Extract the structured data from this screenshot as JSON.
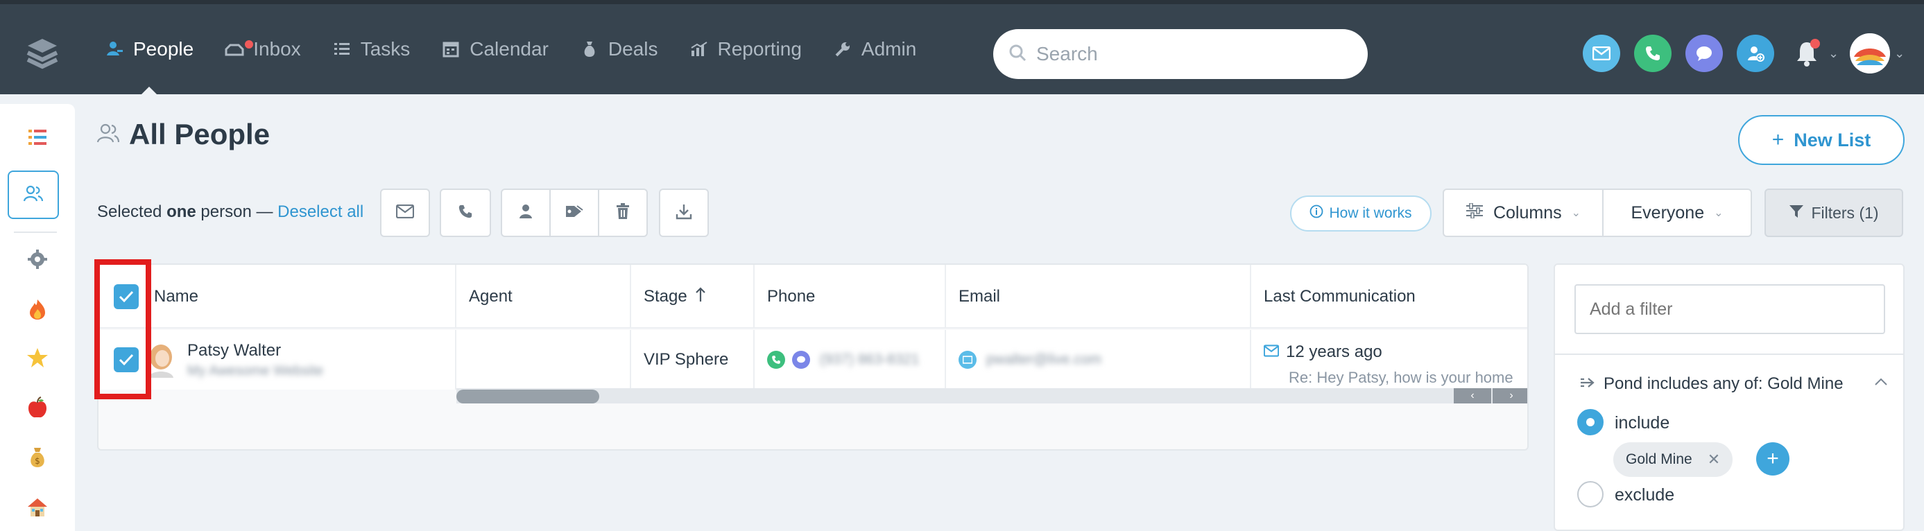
{
  "nav": {
    "items": [
      {
        "label": "People",
        "icon": "person-icon",
        "active": true
      },
      {
        "label": "Inbox",
        "icon": "inbox-icon",
        "badge": true
      },
      {
        "label": "Tasks",
        "icon": "list-icon"
      },
      {
        "label": "Calendar",
        "icon": "calendar-icon"
      },
      {
        "label": "Deals",
        "icon": "money-bag-icon"
      },
      {
        "label": "Reporting",
        "icon": "bar-chart-icon"
      },
      {
        "label": "Admin",
        "icon": "wrench-icon"
      }
    ],
    "search_placeholder": "Search"
  },
  "header": {
    "title": "All People",
    "new_list_label": "New List"
  },
  "toolbar": {
    "selected_prefix": "Selected",
    "selected_count": "one",
    "selected_suffix": "person —",
    "deselect_label": "Deselect all",
    "how_it_works_label": "How it works",
    "columns_label": "Columns",
    "everyone_label": "Everyone",
    "filters_label": "Filters (1)"
  },
  "table": {
    "columns": [
      "Name",
      "Agent",
      "Stage",
      "Phone",
      "Email",
      "Last Communication"
    ],
    "rows": [
      {
        "name": "Patsy Walter",
        "subtitle": "My Awesome Website",
        "agent": "",
        "stage": "VIP Sphere",
        "phone": "(937) 863-8321",
        "email": "pwalter@live.com",
        "last_comm_time": "12 years ago",
        "last_comm_preview": "Re: Hey Patsy, how is your home"
      }
    ]
  },
  "filter_panel": {
    "add_filter_placeholder": "Add a filter",
    "rule_label": "Pond includes any of: Gold Mine",
    "include_label": "include",
    "exclude_label": "exclude",
    "chip_label": "Gold Mine",
    "selected_mode": "include"
  },
  "colors": {
    "nav_bg": "#37444f",
    "accent": "#3fa6dc",
    "highlight": "#e21d1d"
  }
}
